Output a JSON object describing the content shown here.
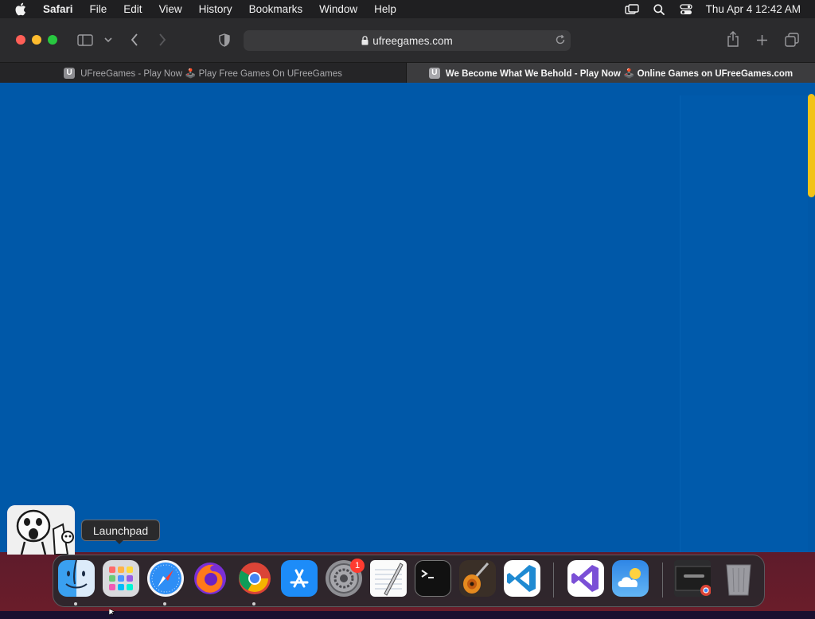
{
  "menubar": {
    "apple_icon": "apple-icon",
    "app_name": "Safari",
    "items": [
      "File",
      "Edit",
      "View",
      "History",
      "Bookmarks",
      "Window",
      "Help"
    ],
    "status_icons": [
      "screen-mirroring-icon",
      "search-icon",
      "control-center-icon"
    ],
    "clock": "Thu Apr 4  12:42 AM"
  },
  "toolbar": {
    "url": "ufreegames.com",
    "icons": [
      "sidebar-icon",
      "chevron-down-icon",
      "back-icon",
      "forward-icon",
      "privacy-shield-icon",
      "lock-icon",
      "reload-icon",
      "share-icon",
      "new-tab-icon",
      "tab-overview-icon"
    ]
  },
  "tabs": [
    {
      "favicon": "U",
      "title": "UFreeGames - Play Now 🕹️ Play Free Games On UFreeGames",
      "active": false
    },
    {
      "favicon": "U",
      "title": "We Become What We Behold - Play Now 🕹️ Online Games on UFreeGames.com",
      "active": true
    }
  ],
  "content": {
    "background": "#0058a8",
    "scrollbar_color": "#f2c318"
  },
  "tooltip": {
    "text": "Launchpad"
  },
  "dock": {
    "apps": [
      "Finder",
      "Launchpad",
      "Safari",
      "Firefox",
      "Google Chrome",
      "App Store",
      "System Settings",
      "TextEdit",
      "Terminal",
      "GarageBand",
      "Visual Studio Code",
      "Visual Studio",
      "Weather",
      "Chrome Window",
      "Trash"
    ],
    "settings_badge": "1"
  }
}
